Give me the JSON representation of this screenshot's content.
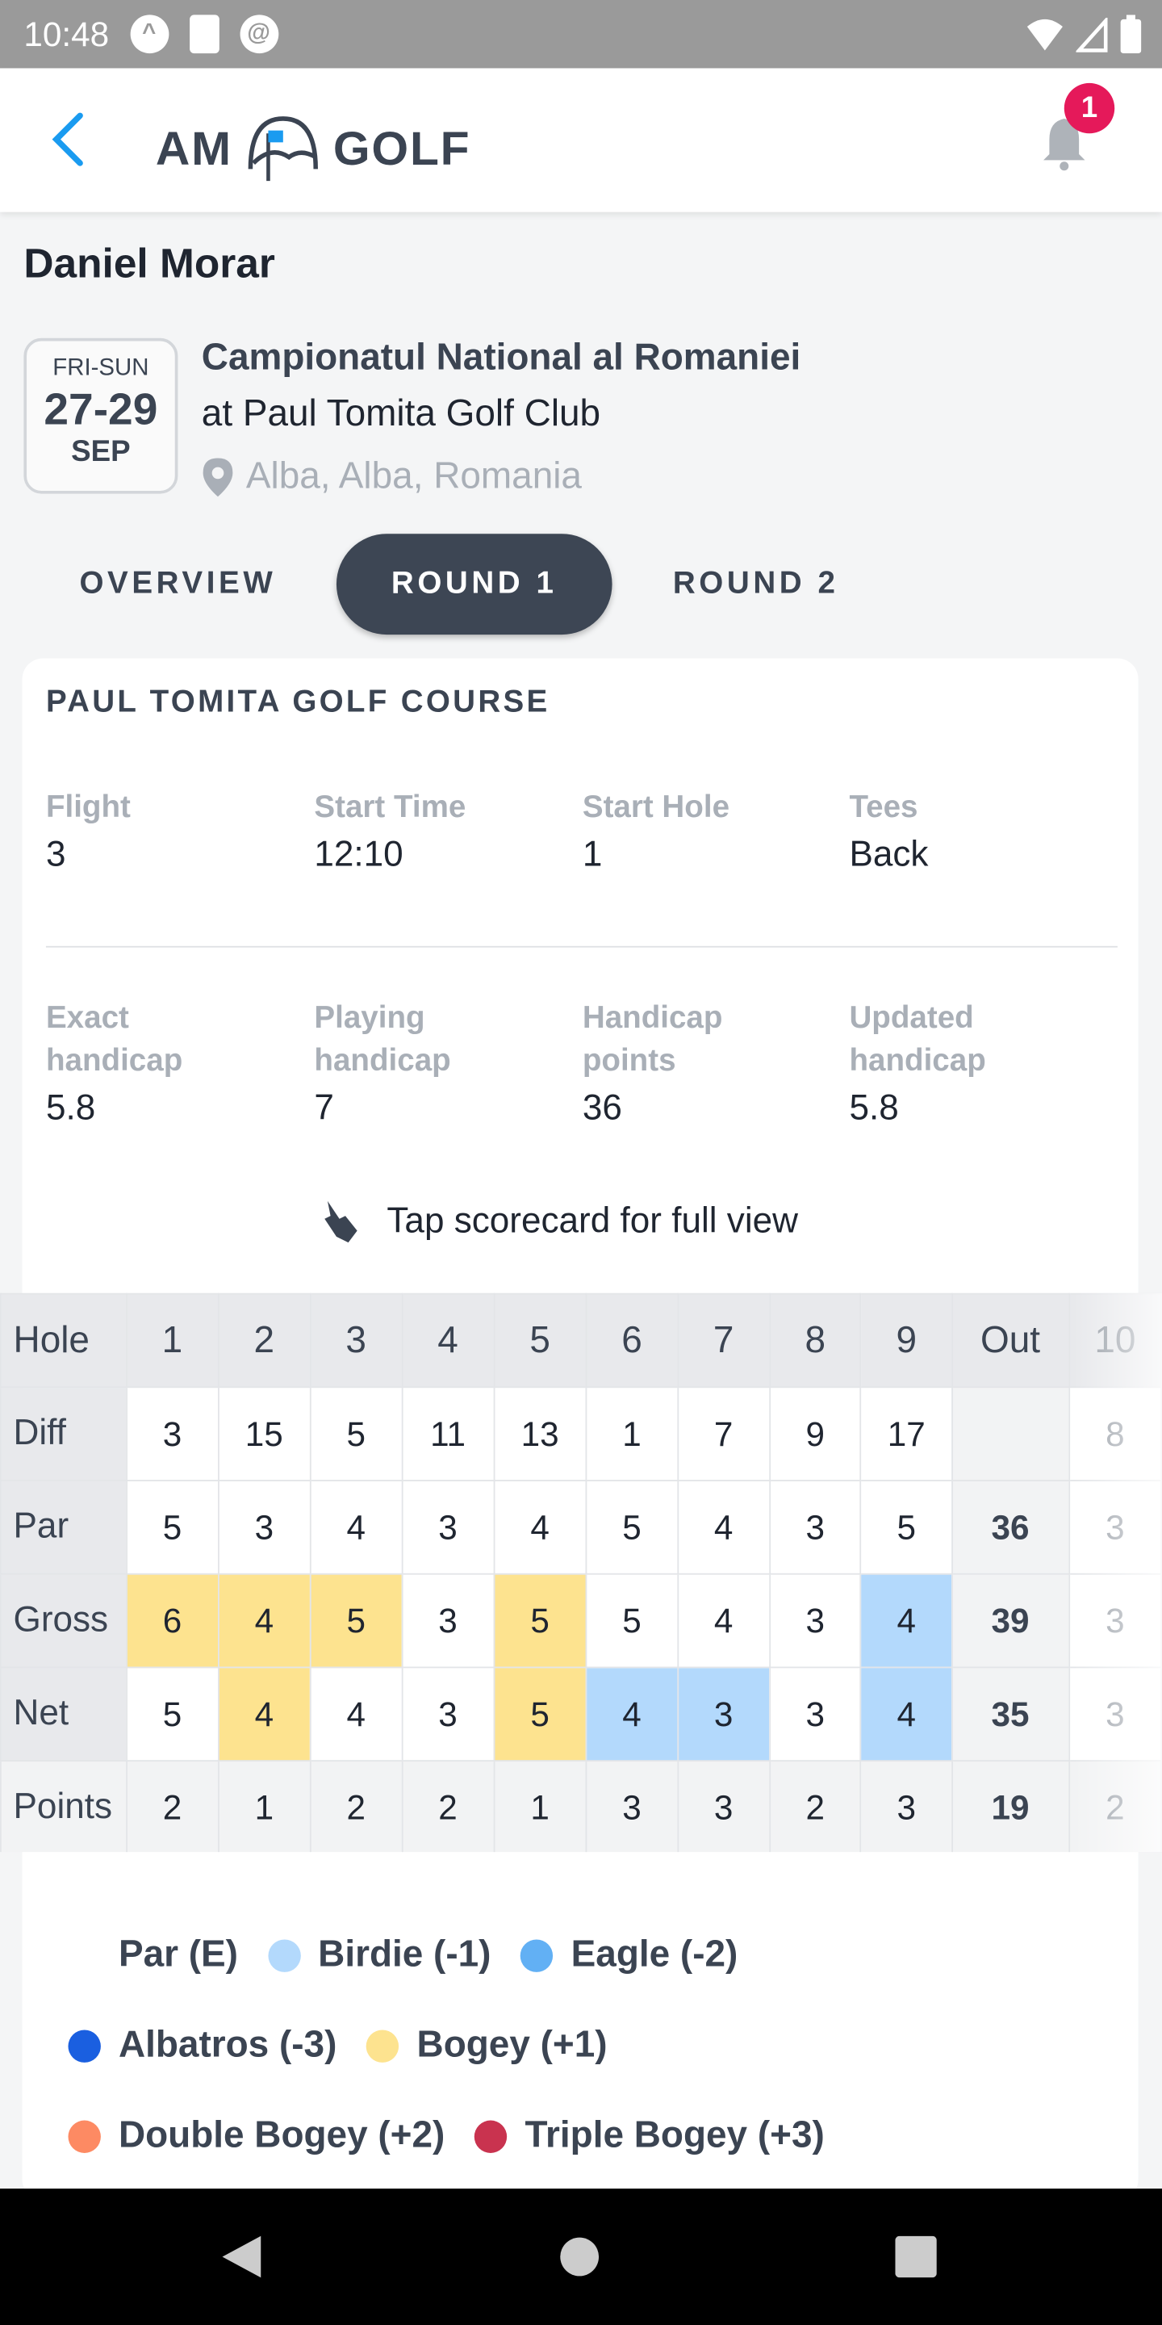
{
  "status_bar": {
    "time": "10:48"
  },
  "header": {
    "logo": "AM GOLF",
    "notification_count": "1",
    "accent": "#1a9bf0"
  },
  "player": {
    "name": "Daniel Morar"
  },
  "event": {
    "days": "FRI-SUN",
    "dates": "27-29",
    "month": "SEP",
    "title": "Campionatul National al Romaniei",
    "club": "at Paul Tomita Golf Club",
    "location": "Alba, Alba, Romania"
  },
  "tabs": [
    {
      "label": "OVERVIEW"
    },
    {
      "label": "ROUND 1",
      "active": true
    },
    {
      "label": "ROUND 2"
    }
  ],
  "round": {
    "course": "PAUL TOMITA GOLF COURSE",
    "info": [
      {
        "label": "Flight",
        "value": "3"
      },
      {
        "label": "Start Time",
        "value": "12:10"
      },
      {
        "label": "Start Hole",
        "value": "1"
      },
      {
        "label": "Tees",
        "value": "Back"
      }
    ],
    "handicap": [
      {
        "label": "Exact handicap",
        "value": "5.8"
      },
      {
        "label": "Playing handicap",
        "value": "7"
      },
      {
        "label": "Handicap points",
        "value": "36"
      },
      {
        "label": "Updated handicap",
        "value": "5.8"
      }
    ],
    "tip": "Tap scorecard for full view"
  },
  "scorecard": {
    "columns": [
      "1",
      "2",
      "3",
      "4",
      "5",
      "6",
      "7",
      "8",
      "9",
      "Out",
      "10"
    ],
    "rows": [
      {
        "label": "Hole",
        "values": [
          "1",
          "2",
          "3",
          "4",
          "5",
          "6",
          "7",
          "8",
          "9",
          "Out",
          "10"
        ]
      },
      {
        "label": "Diff",
        "values": [
          "3",
          "15",
          "5",
          "11",
          "13",
          "1",
          "7",
          "9",
          "17",
          "",
          "8"
        ]
      },
      {
        "label": "Par",
        "values": [
          "5",
          "3",
          "4",
          "3",
          "4",
          "5",
          "4",
          "3",
          "5",
          "36",
          "3"
        ]
      },
      {
        "label": "Gross",
        "values": [
          "6",
          "4",
          "5",
          "3",
          "5",
          "5",
          "4",
          "3",
          "4",
          "39",
          "3"
        ],
        "results": [
          "bogey",
          "bogey",
          "bogey",
          "",
          "bogey",
          "",
          "",
          "",
          "birdie",
          "",
          ""
        ]
      },
      {
        "label": "Net",
        "values": [
          "5",
          "4",
          "4",
          "3",
          "5",
          "4",
          "3",
          "3",
          "4",
          "35",
          "3"
        ],
        "results": [
          "",
          "bogey",
          "",
          "",
          "bogey",
          "birdie",
          "birdie",
          "",
          "birdie",
          "",
          ""
        ]
      },
      {
        "label": "Points",
        "values": [
          "2",
          "1",
          "2",
          "2",
          "1",
          "3",
          "3",
          "2",
          "3",
          "19",
          "2"
        ]
      }
    ]
  },
  "legend": [
    {
      "label": "Par (E)",
      "color": "#ffffff"
    },
    {
      "label": "Birdie (-1)",
      "color": "#b3d9fc"
    },
    {
      "label": "Eagle (-2)",
      "color": "#62b0f4"
    },
    {
      "label": "Albatros (-3)",
      "color": "#1a5fe0"
    },
    {
      "label": "Bogey (+1)",
      "color": "#fde38f"
    },
    {
      "label": "Double Bogey (+2)",
      "color": "#fd8a63"
    },
    {
      "label": "Triple Bogey (+3)",
      "color": "#c9334f"
    }
  ]
}
